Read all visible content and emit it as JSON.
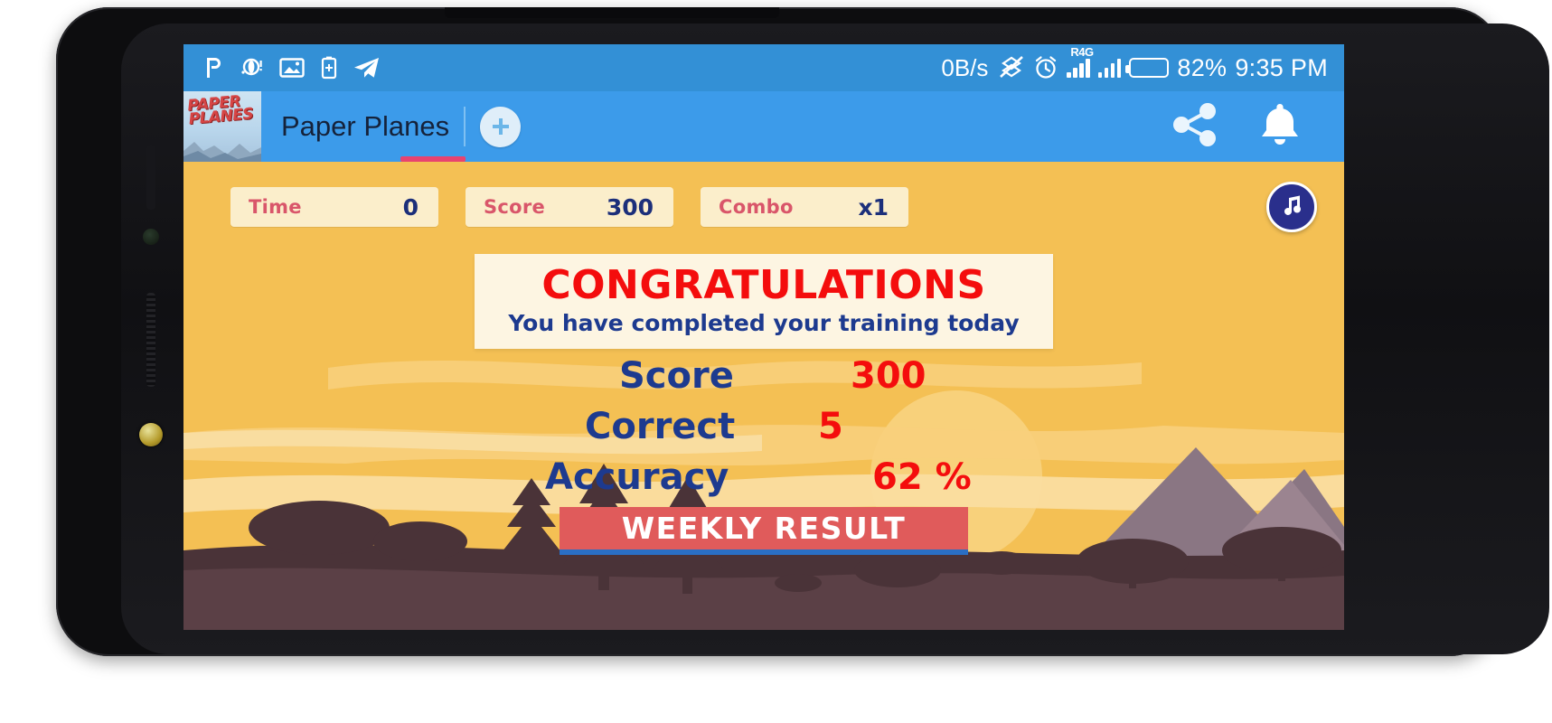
{
  "device": {
    "frame": "android-phone-landscape"
  },
  "status_bar": {
    "left_icons": [
      "pinterest-icon",
      "opera-icon",
      "screenshot-icon",
      "battery-saver-icon",
      "telegram-icon"
    ],
    "network_speed": "0B/s",
    "icons": [
      "data-sync-off-icon",
      "alarm-icon"
    ],
    "signal_label": "R4G",
    "battery_percent": "82%",
    "time": "9:35 PM"
  },
  "app_bar": {
    "title": "Paper Planes",
    "logo_line1": "PAPER",
    "logo_line2": "PLANES",
    "add_icon": "plus-icon",
    "share_icon": "share-icon",
    "notification_icon": "bell-icon"
  },
  "hud": {
    "stats": [
      {
        "label": "Time",
        "value": "0"
      },
      {
        "label": "Score",
        "value": "300"
      },
      {
        "label": "Combo",
        "value": "x1"
      }
    ],
    "music_icon": "music-note-icon"
  },
  "congrats": {
    "title": "CONGRATULATIONS",
    "subtitle": "You have completed your training today"
  },
  "results": {
    "rows": [
      {
        "label": "Score",
        "value": "300"
      },
      {
        "label": "Correct",
        "value": "5"
      },
      {
        "label": "Accuracy",
        "value": "62 %"
      }
    ]
  },
  "actions": {
    "weekly_result": "WEEKLY RESULT"
  },
  "colors": {
    "status_bar": "#3390d6",
    "app_bar": "#3c9bea",
    "game_bg": "#f4c054",
    "panel_bg": "#fdf5e2",
    "title_red": "#f40d0d",
    "label_blue": "#1d3a8f",
    "button_red": "#e05b5b",
    "tab_accent": "#e8436f"
  }
}
